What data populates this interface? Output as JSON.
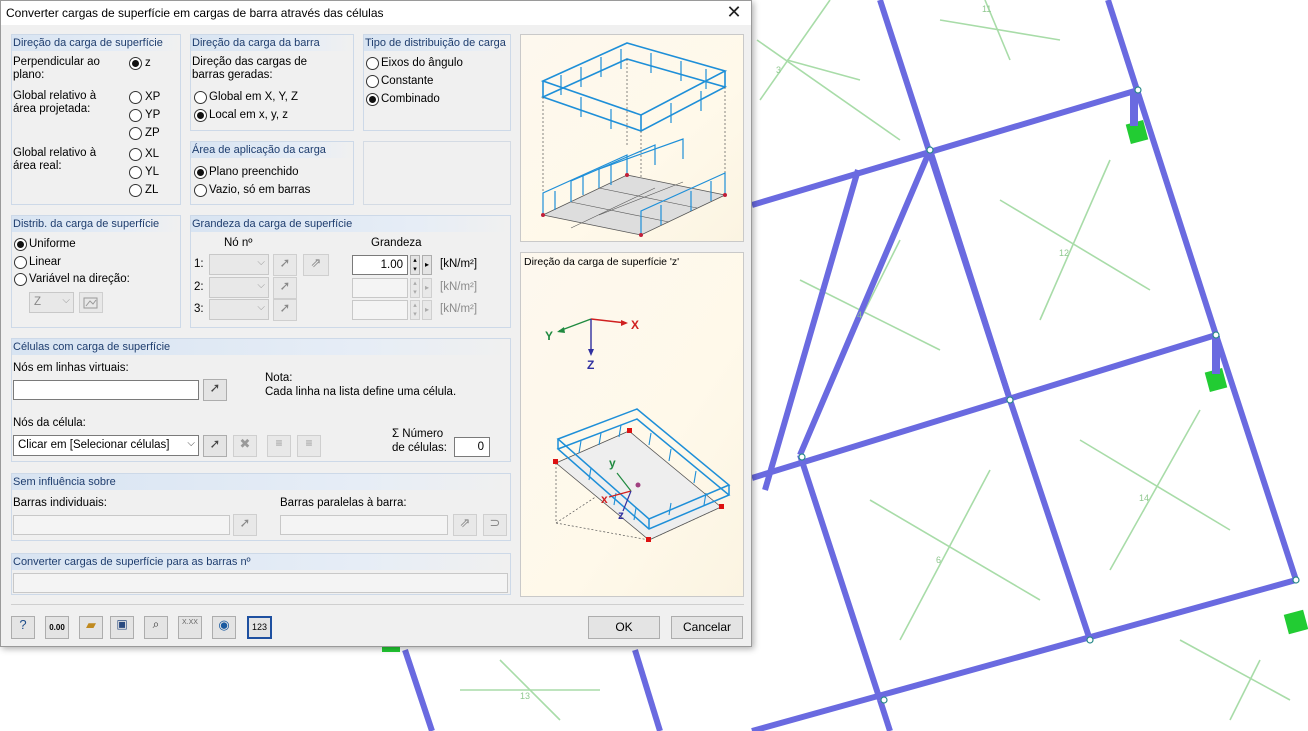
{
  "window": {
    "title": "Converter cargas de superfície em cargas de barra através das células"
  },
  "surface_dir": {
    "header": "Direção da carga de superfície",
    "perp_label": "Perpendicular ao plano:",
    "opt_z": "z",
    "proj_label": "Global relativo à área projetada:",
    "opt_xp": "XP",
    "opt_yp": "YP",
    "opt_zp": "ZP",
    "real_label": "Global relativo à área real:",
    "opt_xl": "XL",
    "opt_yl": "YL",
    "opt_zl": "ZL",
    "selected": "z"
  },
  "member_dir": {
    "header": "Direção da carga da barra",
    "desc": "Direção das cargas de barras geradas:",
    "opt_global": "Global em X, Y, Z",
    "opt_local": "Local em x, y, z",
    "selected": "local"
  },
  "dist_type": {
    "header": "Tipo de distribuição de carga",
    "opt_angle": "Eixos do ângulo",
    "opt_const": "Constante",
    "opt_comb": "Combinado",
    "selected": "combinado"
  },
  "app_area": {
    "header": "Área de aplicação da carga",
    "opt_filled": "Plano preenchido",
    "opt_void": "Vazio, só em barras",
    "selected": "filled"
  },
  "distrib": {
    "header": "Distrib. da carga de superfície",
    "opt_uniform": "Uniforme",
    "opt_linear": "Linear",
    "opt_variable": "Variável na direção:",
    "dir_value": "Z",
    "selected": "uniform"
  },
  "magnitude": {
    "header": "Grandeza da carga de superfície",
    "col_node": "Nó nº",
    "col_value": "Grandeza",
    "rows": [
      {
        "idx": "1:",
        "value": "1.00",
        "unit": "[kN/m²]"
      },
      {
        "idx": "2:",
        "value": "",
        "unit": "[kN/m²]"
      },
      {
        "idx": "3:",
        "value": "",
        "unit": "[kN/m²]"
      }
    ]
  },
  "cells": {
    "header": "Células com carga de superfície",
    "nodes_label": "Nós em linhas virtuais:",
    "nodes_value": "",
    "note_label": "Nota:",
    "note_text": "Cada linha na lista define uma célula.",
    "cell_nodes_label": "Nós da célula:",
    "cell_nodes_value": "Clicar em [Selecionar células]",
    "count_label_1": "Σ Número",
    "count_label_2": "de células:",
    "count_value": "0"
  },
  "no_influence": {
    "header": "Sem influência sobre",
    "single_label": "Barras individuais:",
    "parallel_label": "Barras paralelas à barra:"
  },
  "convert_to": {
    "header": "Converter cargas de superfície para as barras nº",
    "value": ""
  },
  "preview2": {
    "caption": "Direção da carga de superfície 'z'",
    "axis_x": "X",
    "axis_y": "Y",
    "axis_z": "Z",
    "loc_y": "y",
    "loc_x": "x",
    "loc_z": "z"
  },
  "footer": {
    "ok": "OK",
    "cancel": "Cancelar",
    "units_icon": "0.00",
    "num_icon": "123",
    "xxx_icon": "X.XX"
  },
  "model_labels": [
    "11",
    "3",
    "12",
    "4",
    "14",
    "6",
    "13"
  ],
  "colors": {
    "member": "#6a6ae0",
    "support": "#22cc33",
    "fe_line": "#a8dca8",
    "header_text": "#1e3d6e",
    "load_blue": "#1e8fd8"
  }
}
